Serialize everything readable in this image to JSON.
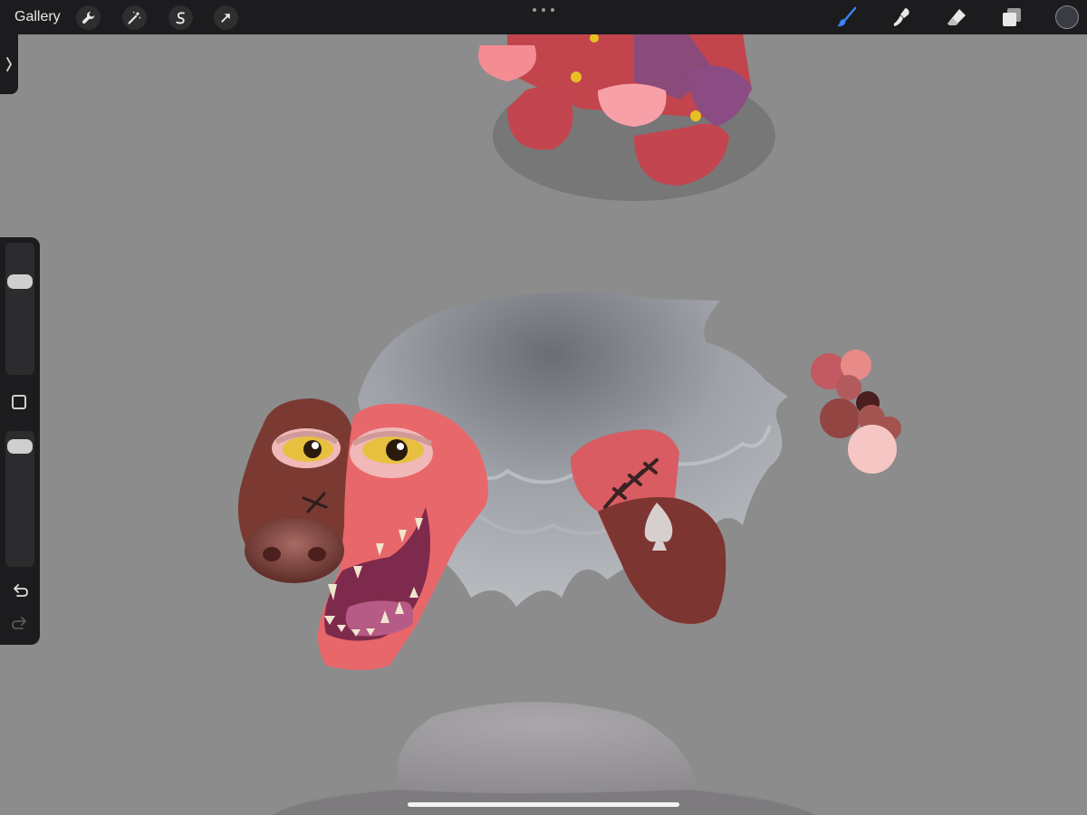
{
  "toolbar": {
    "gallery_label": "Gallery",
    "left_tools": [
      {
        "name": "actions",
        "icon": "wrench-icon"
      },
      {
        "name": "adjustments",
        "icon": "magic-wand-icon"
      },
      {
        "name": "selection",
        "icon": "selection-s-icon"
      },
      {
        "name": "transform",
        "icon": "arrow-cursor-icon"
      }
    ],
    "right_tools": [
      {
        "name": "brush",
        "icon": "brush-icon",
        "active": true
      },
      {
        "name": "smudge",
        "icon": "smudge-icon",
        "active": false
      },
      {
        "name": "eraser",
        "icon": "eraser-icon",
        "active": false
      },
      {
        "name": "layers",
        "icon": "layers-icon",
        "active": false
      }
    ],
    "current_color": "#3a3c44",
    "accent_color": "#3b82f6"
  },
  "sidebar": {
    "brush_size_level": 0.73,
    "opacity_level": 0.93,
    "modify_icon": "square-outline-icon",
    "undo_icon": "undo-arrow-icon",
    "redo_icon": "redo-arrow-icon"
  },
  "artwork": {
    "palette": [
      "#c35a62",
      "#e88b88",
      "#b25a5c",
      "#4a1e1e",
      "#934542",
      "#a45551",
      "#a4514f",
      "#f6c6c4"
    ],
    "fur_color": "#e8676b",
    "brown_color": "#7a3a32",
    "mane_color": "#9da0a6"
  }
}
